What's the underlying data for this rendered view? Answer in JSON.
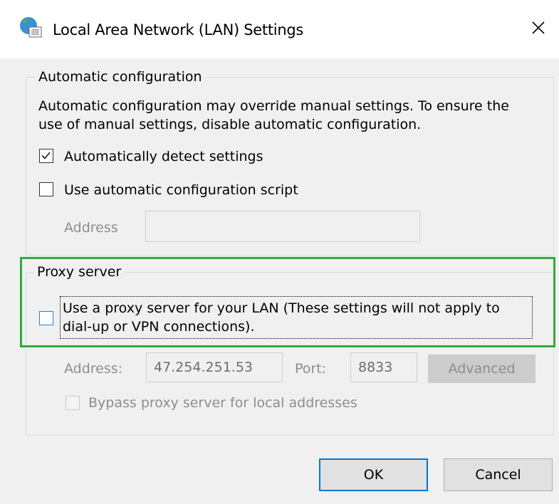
{
  "window": {
    "title": "Local Area Network (LAN) Settings",
    "icon": "globe-network-icon",
    "close_glyph": "✕"
  },
  "auto_config": {
    "legend": "Automatic configuration",
    "description_line1": "Automatic configuration may override manual settings.  To ensure the",
    "description_line2": "use of manual settings, disable automatic configuration.",
    "detect": {
      "label": "Automatically detect settings",
      "checked": true
    },
    "script": {
      "label": "Use automatic configuration script",
      "checked": false
    },
    "address_label": "Address",
    "address_value": ""
  },
  "proxy": {
    "legend": "Proxy server",
    "use_proxy": {
      "label_line1": "Use a proxy server for your LAN (These settings will not apply to",
      "label_line2": "dial-up or VPN connections).",
      "checked": false
    },
    "address_label": "Address:",
    "address_value": "47.254.251.53",
    "port_label": "Port:",
    "port_value": "8833",
    "advanced_label": "Advanced",
    "bypass": {
      "label": "Bypass proxy server for local addresses",
      "checked": false
    }
  },
  "buttons": {
    "ok": "OK",
    "cancel": "Cancel"
  },
  "colors": {
    "highlight": "#2eab3a",
    "focus_blue": "#0078d7"
  }
}
